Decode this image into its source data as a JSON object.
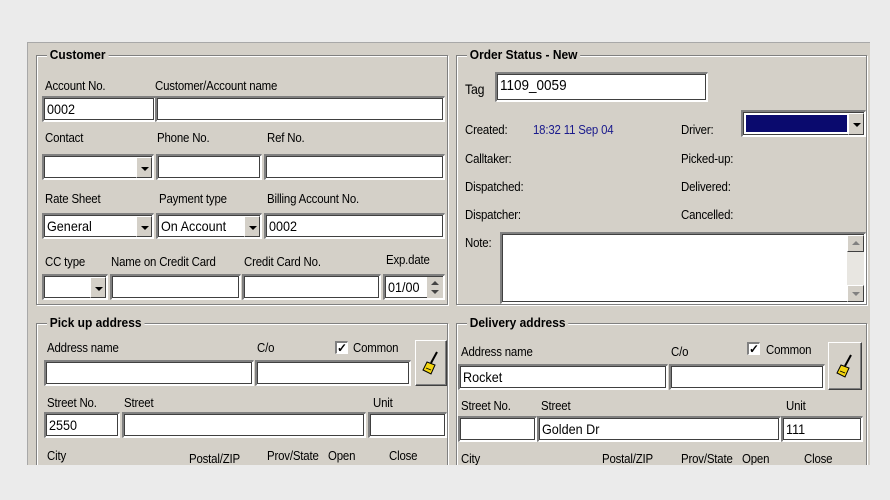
{
  "customer": {
    "legend": "Customer",
    "account_no_label": "Account No.",
    "account_no_value": "0002",
    "account_name_label": "Customer/Account name",
    "account_name_value": "",
    "contact_label": "Contact",
    "phone_label": "Phone No.",
    "ref_label": "Ref No.",
    "rate_sheet_label": "Rate Sheet",
    "rate_sheet_value": "General",
    "payment_type_label": "Payment type",
    "payment_type_value": "On Account",
    "billing_account_label": "Billing Account No.",
    "billing_account_value": "0002",
    "cc_type_label": "CC type",
    "name_on_card_label": "Name on Credit Card",
    "card_no_label": "Credit Card No.",
    "exp_date_label": "Exp.date",
    "exp_date_value": "01/00"
  },
  "order_status": {
    "legend": "Order Status - New",
    "tag_label": "Tag",
    "tag_value": "1109_0059",
    "created_label": "Created:",
    "created_value": "18:32 11 Sep 04",
    "calltaker_label": "Calltaker:",
    "dispatched_label": "Dispatched:",
    "dispatcher_label": "Dispatcher:",
    "driver_label": "Driver:",
    "picked_up_label": "Picked-up:",
    "delivered_label": "Delivered:",
    "cancelled_label": "Cancelled:",
    "note_label": "Note:",
    "driver_color": "#0a0a6e"
  },
  "pickup": {
    "legend": "Pick up address",
    "address_name_label": "Address name",
    "address_name_value": "",
    "co_label": "C/o",
    "common_label": "Common",
    "common_checked": "✓",
    "street_no_label": "Street No.",
    "street_no_value": "2550",
    "street_label": "Street",
    "street_value": "",
    "unit_label": "Unit",
    "unit_value": "",
    "city_label": "City",
    "postal_label": "Postal/ZIP",
    "prov_label": "Prov/State",
    "open_label": "Open",
    "close_label": "Close"
  },
  "delivery": {
    "legend": "Delivery address",
    "address_name_label": "Address name",
    "address_name_value": "Rocket",
    "co_label": "C/o",
    "common_label": "Common",
    "common_checked": "✓",
    "street_no_label": "Street No.",
    "street_no_value": "",
    "street_label": "Street",
    "street_value": "Golden Dr",
    "unit_label": "Unit",
    "unit_value": "111",
    "city_label": "City",
    "postal_label": "Postal/ZIP",
    "prov_label": "Prov/State",
    "open_label": "Open",
    "close_label": "Close"
  },
  "icons": {
    "clear_button": "broom-icon"
  }
}
